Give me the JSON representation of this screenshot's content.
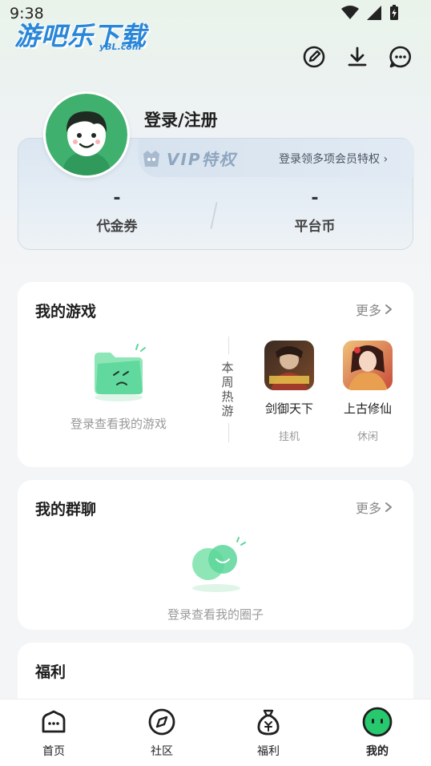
{
  "status_bar": {
    "time": "9:38"
  },
  "watermark": {
    "text": "游吧乐下载",
    "sub": "yBL.com"
  },
  "profile": {
    "login_label": "登录/注册",
    "vip_badge": "VIP特权",
    "vip_tip": "登录领多项会员特权 ›",
    "stats": [
      {
        "value": "-",
        "label": "代金券"
      },
      {
        "value": "-",
        "label": "平台币"
      }
    ]
  },
  "my_games": {
    "title": "我的游戏",
    "more": "更多",
    "empty_text": "登录查看我的游戏",
    "weekly_label": "本周热游",
    "games": [
      {
        "name": "剑御天下",
        "tag": "挂机"
      },
      {
        "name": "上古修仙",
        "tag": "休闲"
      }
    ]
  },
  "my_groups": {
    "title": "我的群聊",
    "more": "更多",
    "empty_text": "登录查看我的圈子"
  },
  "welfare": {
    "title": "福利"
  },
  "tabbar": {
    "items": [
      {
        "label": "首页",
        "icon": "home-icon"
      },
      {
        "label": "社区",
        "icon": "compass-icon"
      },
      {
        "label": "福利",
        "icon": "money-bag-icon"
      },
      {
        "label": "我的",
        "icon": "mascot-icon",
        "active": true
      }
    ]
  },
  "colors": {
    "accent_green": "#27c96e",
    "vip_text": "#8fa6bf"
  }
}
